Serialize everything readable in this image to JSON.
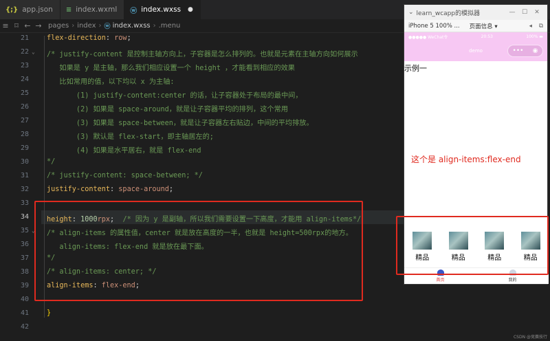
{
  "tabs": [
    {
      "icon": "{;}",
      "label": "app.json"
    },
    {
      "icon": "≡",
      "label": "index.wxml"
    },
    {
      "icon": "ⓦ",
      "label": "index.wxss",
      "modified": "●"
    }
  ],
  "breadcrumb": {
    "parts": [
      "pages",
      "index"
    ],
    "file": "index.wxss",
    "selector": ".menu"
  },
  "editor": {
    "line_numbers": [
      "21",
      "22",
      "23",
      "24",
      "25",
      "26",
      "27",
      "28",
      "29",
      "30",
      "31",
      "32",
      "33",
      "34",
      "35",
      "36",
      "37",
      "38",
      "39",
      "40",
      "41",
      "42"
    ],
    "current_line": "34",
    "lines": [
      [
        {
          "c": "pr",
          "t": "flex-direction"
        },
        {
          "c": "pl",
          "t": ": "
        },
        {
          "c": "vl",
          "t": "row"
        },
        {
          "c": "pl",
          "t": ";"
        }
      ],
      [
        {
          "c": "cm",
          "t": "/* justify-content 是控制主轴方向上，子容器是怎么排列的。也就是元素在主轴方向如何展示"
        }
      ],
      [
        {
          "c": "cm",
          "t": "   如果是 y 是主轴，那么我们相应设置一个 height ，才能看到相应的效果"
        }
      ],
      [
        {
          "c": "cm",
          "t": "   比如常用的值，以下均以 x 为主轴:"
        }
      ],
      [
        {
          "c": "cm",
          "t": "       (1) justify-content:center 的话，让子容器处于布局的最中间，"
        }
      ],
      [
        {
          "c": "cm",
          "t": "       (2) 如果是 space-around，就是让子容器平均的排列，这个常用"
        }
      ],
      [
        {
          "c": "cm",
          "t": "       (3) 如果是 space-between，就是让子容器左右贴边，中间的平均排放。"
        }
      ],
      [
        {
          "c": "cm",
          "t": "       (3) 默认是 flex-start，即主轴居左的;"
        }
      ],
      [
        {
          "c": "cm",
          "t": "       (4) 如果是水平居右，就是 flex-end"
        }
      ],
      [
        {
          "c": "cm",
          "t": "*/"
        }
      ],
      [
        {
          "c": "cm",
          "t": "/* justify-content: space-between; */"
        }
      ],
      [
        {
          "c": "pr",
          "t": "justify-content"
        },
        {
          "c": "pl",
          "t": ": "
        },
        {
          "c": "vl",
          "t": "space-around"
        },
        {
          "c": "pl",
          "t": ";"
        }
      ],
      [],
      [
        {
          "c": "pr",
          "t": "height"
        },
        {
          "c": "pl",
          "t": ": "
        },
        {
          "c": "nm",
          "t": "1000"
        },
        {
          "c": "vl",
          "t": "rpx"
        },
        {
          "c": "pl",
          "t": ";  "
        },
        {
          "c": "cm",
          "t": "/* 因为 y 是副轴，所以我们需要设置一下高度，才能用 align-items*/"
        }
      ],
      [
        {
          "c": "cm",
          "t": "/* align-items 的属性值，center 就是放在高度的一半，也就是 height=500rpx的地方。"
        }
      ],
      [
        {
          "c": "cm",
          "t": "   align-items: flex-end 就是放在最下面。"
        }
      ],
      [
        {
          "c": "cm",
          "t": "*/"
        }
      ],
      [
        {
          "c": "cm",
          "t": "/* align-items: center; */"
        }
      ],
      [
        {
          "c": "pr",
          "t": "align-items"
        },
        {
          "c": "pl",
          "t": ": "
        },
        {
          "c": "vl",
          "t": "flex-end"
        },
        {
          "c": "pl",
          "t": ";"
        }
      ],
      [],
      [
        {
          "c": "br",
          "t": "}"
        }
      ],
      []
    ]
  },
  "simulator": {
    "title": "learn_wcapp的模拟器",
    "device": "iPhone 5 100% ...",
    "page_info": "页面信息 ▾",
    "status_left": "●●●●● WeChat令",
    "status_time": "20:53",
    "status_right": "100% ▬",
    "nav_title": "demo",
    "capsule_more": "•••",
    "capsule_close": "◉",
    "example_label": "示例一",
    "red_text": "这个是 align-items:flex-end",
    "items": [
      "精品",
      "精品",
      "精品",
      "精品"
    ],
    "tab_home": "首页",
    "tab_mine": "我的"
  },
  "watermark": "CSDN @竞赛技行"
}
